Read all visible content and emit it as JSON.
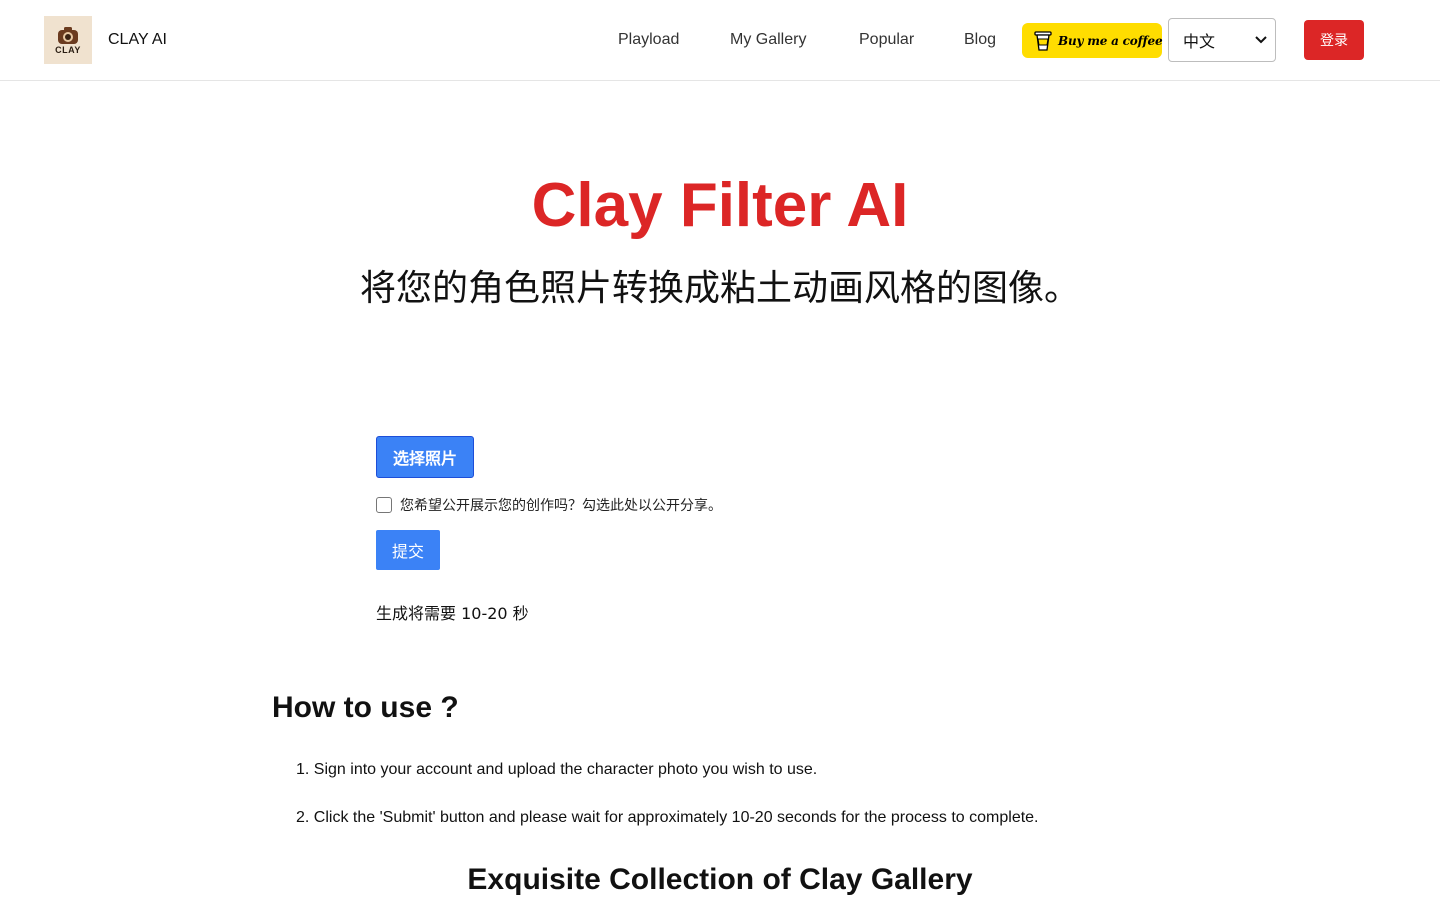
{
  "header": {
    "brand_name": "CLAY AI",
    "logo_text": "CLAY",
    "nav": [
      "Playload",
      "My Gallery",
      "Popular",
      "Blog"
    ],
    "coffee_label": "Buy me a coffee",
    "language_selected": "中文",
    "login_label": "登录"
  },
  "hero": {
    "title": "Clay Filter AI",
    "subtitle": "将您的角色照片转换成粘土动画风格的图像。"
  },
  "form": {
    "choose_photo_label": "选择照片",
    "share_label": "您希望公开展示您的创作吗？勾选此处以公开分享。",
    "share_checked": false,
    "submit_label": "提交",
    "generation_note": "生成将需要 10-20 秒"
  },
  "how_to": {
    "title": "How to use ?",
    "steps": [
      "1. Sign into your account and upload the character photo you wish to use.",
      "2. Click the 'Submit' button and please wait for approximately 10-20 seconds for the process to complete."
    ]
  },
  "gallery": {
    "title": "Exquisite Collection of Clay Gallery"
  },
  "colors": {
    "accent_red": "#dc2626",
    "primary_blue": "#3b82f6",
    "coffee_yellow": "#ffdd00"
  }
}
